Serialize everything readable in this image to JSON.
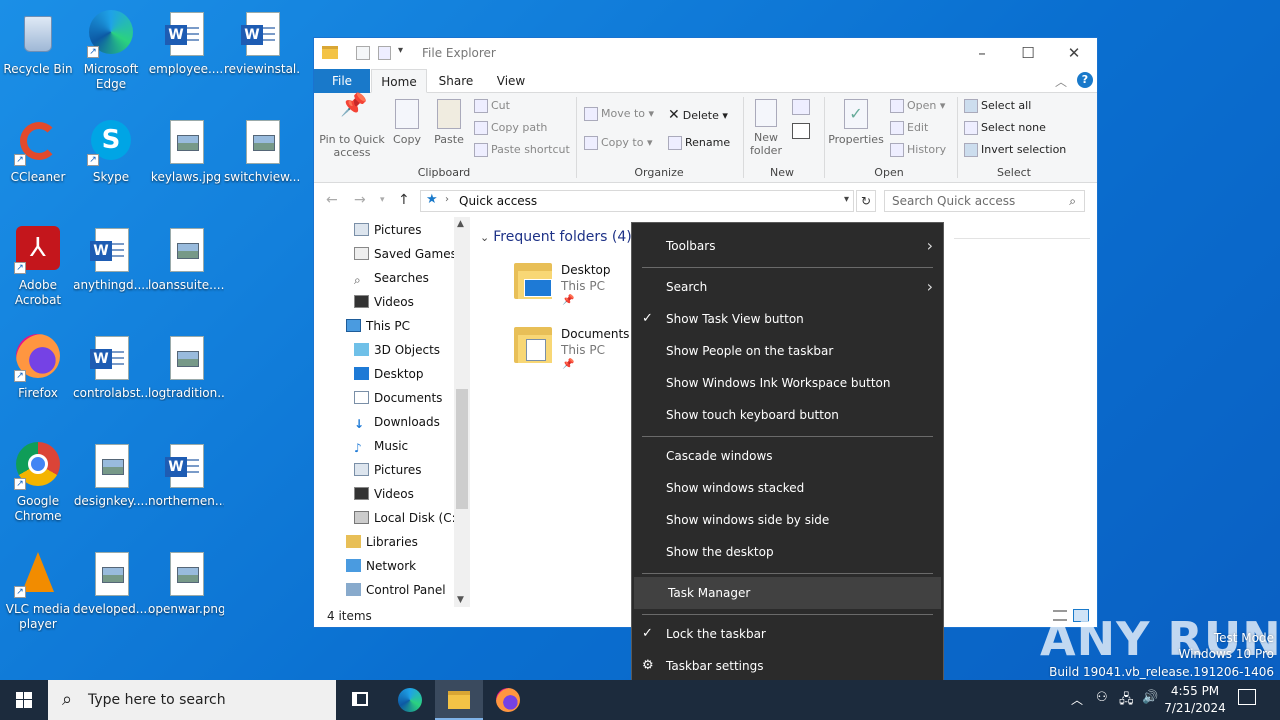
{
  "desktop": {
    "icons": [
      {
        "label": "Recycle Bin",
        "icon": "recycle-bin-icon"
      },
      {
        "label": "Microsoft Edge",
        "icon": "edge-icon"
      },
      {
        "label": "employee....",
        "icon": "word-doc-icon"
      },
      {
        "label": "reviewinstal...",
        "icon": "word-doc-icon"
      },
      {
        "label": "CCleaner",
        "icon": "ccleaner-icon"
      },
      {
        "label": "Skype",
        "icon": "skype-icon"
      },
      {
        "label": "keylaws.jpg",
        "icon": "image-file-icon"
      },
      {
        "label": "switchview....",
        "icon": "image-file-icon"
      },
      {
        "label": "Adobe Acrobat",
        "icon": "acrobat-icon"
      },
      {
        "label": "anythingd....",
        "icon": "word-doc-icon"
      },
      {
        "label": "loanssuite....",
        "icon": "image-file-icon"
      },
      {
        "label": "Firefox",
        "icon": "firefox-icon"
      },
      {
        "label": "controlabst...",
        "icon": "word-doc-icon"
      },
      {
        "label": "logtradition...",
        "icon": "image-file-icon"
      },
      {
        "label": "Google Chrome",
        "icon": "chrome-icon"
      },
      {
        "label": "designkey....",
        "icon": "image-file-icon"
      },
      {
        "label": "northernen....",
        "icon": "word-doc-icon"
      },
      {
        "label": "VLC media player",
        "icon": "vlc-icon"
      },
      {
        "label": "developed....",
        "icon": "image-file-icon"
      },
      {
        "label": "openwar.png",
        "icon": "image-file-icon"
      }
    ]
  },
  "explorer": {
    "title": "File Explorer",
    "tabs": [
      "File",
      "Home",
      "Share",
      "View"
    ],
    "ribbon": {
      "clipboard": {
        "pin": "Pin to Quick access",
        "copy": "Copy",
        "paste": "Paste",
        "cut": "Cut",
        "copy_path": "Copy path",
        "paste_shortcut": "Paste shortcut",
        "label": "Clipboard"
      },
      "organize": {
        "move_to": "Move to",
        "copy_to": "Copy to",
        "delete": "Delete",
        "rename": "Rename",
        "label": "Organize"
      },
      "new": {
        "new_folder": "New folder",
        "label": "New"
      },
      "open": {
        "properties": "Properties",
        "open": "Open",
        "edit": "Edit",
        "history": "History",
        "label": "Open"
      },
      "select": {
        "select_all": "Select all",
        "select_none": "Select none",
        "invert": "Invert selection",
        "label": "Select"
      }
    },
    "address": "Quick access",
    "search_placeholder": "Search Quick access",
    "tree": [
      "Pictures",
      "Saved Games",
      "Searches",
      "Videos",
      "This PC",
      "3D Objects",
      "Desktop",
      "Documents",
      "Downloads",
      "Music",
      "Pictures",
      "Videos",
      "Local Disk (C:)",
      "Libraries",
      "Network",
      "Control Panel"
    ],
    "section": "Frequent folders (4)",
    "folders": [
      {
        "name": "Desktop",
        "location": "This PC"
      },
      {
        "name": "Documents",
        "location": "This PC"
      }
    ],
    "status": "4 items"
  },
  "context_menu": {
    "items": [
      "Toolbars",
      "Search",
      "Show Task View button",
      "Show People on the taskbar",
      "Show Windows Ink Workspace button",
      "Show touch keyboard button",
      "Cascade windows",
      "Show windows stacked",
      "Show windows side by side",
      "Show the desktop",
      "Task Manager",
      "Lock the taskbar",
      "Taskbar settings"
    ]
  },
  "taskbar": {
    "search_placeholder": "Type here to search",
    "time": "4:55 PM",
    "date": "7/21/2024"
  },
  "watermark": {
    "brand": "ANY RUN",
    "line1": "Test Mode",
    "line2": "Windows 10 Pro",
    "line3": "Build 19041.vb_release.191206-1406"
  }
}
